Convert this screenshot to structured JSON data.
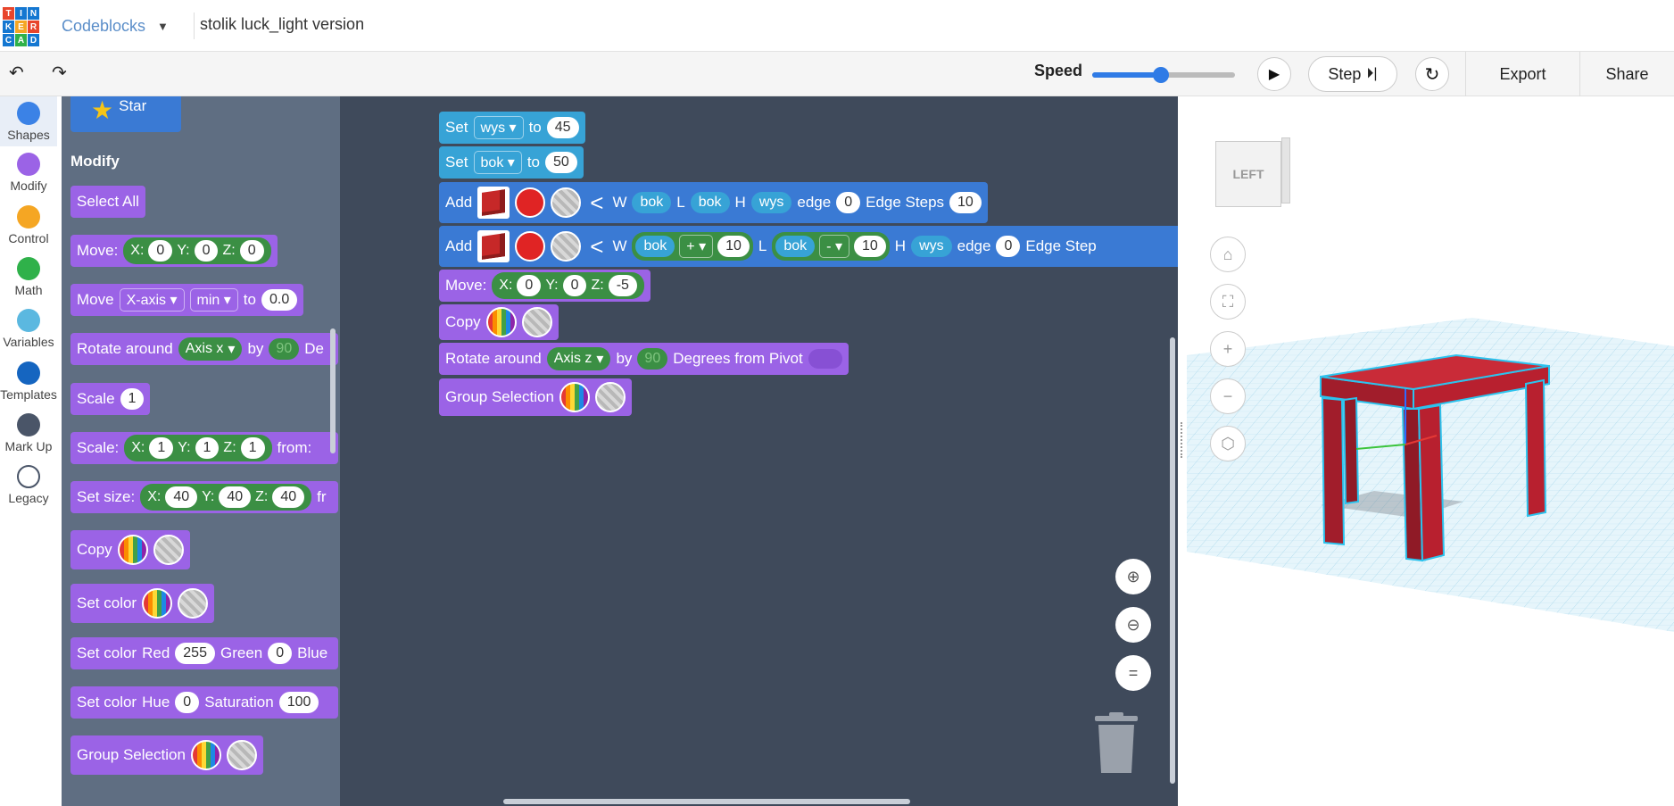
{
  "app": {
    "logo_letters": [
      "T",
      "I",
      "N",
      "K",
      "E",
      "R",
      "C",
      "A",
      "D"
    ],
    "app_name": "Codeblocks",
    "project_title": "stolik luck_light version"
  },
  "toolbar": {
    "undo": "↶",
    "redo": "↷",
    "speed_label": "Speed",
    "speed_value": 0.48,
    "step_label": "Step",
    "export_label": "Export",
    "share_label": "Share"
  },
  "categories": [
    {
      "label": "Shapes",
      "color": "#3b82e6"
    },
    {
      "label": "Modify",
      "color": "#9b63e6"
    },
    {
      "label": "Control",
      "color": "#f5a623"
    },
    {
      "label": "Math",
      "color": "#2fb14a"
    },
    {
      "label": "Variables",
      "color": "#5bb8e0"
    },
    {
      "label": "Templates",
      "color": "#1565c0"
    },
    {
      "label": "Mark Up",
      "color": "#4a5568"
    },
    {
      "label": "Legacy",
      "color": "#ffffff"
    }
  ],
  "flyout": {
    "star_label": "Star",
    "section": "Modify",
    "select_all": "Select All",
    "move": {
      "label": "Move:",
      "x": "X:",
      "xv": "0",
      "y": "Y:",
      "yv": "0",
      "z": "Z:",
      "zv": "0"
    },
    "move_axis": {
      "label": "Move",
      "axis": "X-axis",
      "mode": "min",
      "to": "to",
      "value": "0.0"
    },
    "rotate": {
      "label": "Rotate around",
      "axis": "Axis x",
      "by": "by",
      "value": "90",
      "deg": "De"
    },
    "scale": {
      "label": "Scale",
      "value": "1"
    },
    "scale_xyz": {
      "label": "Scale:",
      "x": "X:",
      "xv": "1",
      "y": "Y:",
      "yv": "1",
      "z": "Z:",
      "zv": "1",
      "from": "from:"
    },
    "set_size": {
      "label": "Set size:",
      "x": "X:",
      "xv": "40",
      "y": "Y:",
      "yv": "40",
      "z": "Z:",
      "zv": "40",
      "from": "fr"
    },
    "copy": "Copy",
    "set_color": "Set color",
    "set_color_rgb": {
      "label": "Set color",
      "red": "Red",
      "rv": "255",
      "green": "Green",
      "gv": "0",
      "blue": "Blue"
    },
    "set_color_hsv": {
      "label": "Set color",
      "hue": "Hue",
      "hv": "0",
      "sat": "Saturation",
      "sv": "100"
    },
    "group": "Group Selection"
  },
  "workspace": {
    "set1": {
      "label": "Set",
      "var": "wys",
      "to": "to",
      "value": "45"
    },
    "set2": {
      "label": "Set",
      "var": "bok",
      "to": "to",
      "value": "50"
    },
    "add1": {
      "label": "Add",
      "w": "W",
      "wv": "bok",
      "l": "L",
      "lv": "bok",
      "h": "H",
      "hv": "wys",
      "edge": "edge",
      "edgev": "0",
      "steps": "Edge Steps",
      "stepsv": "10"
    },
    "add2": {
      "label": "Add",
      "w": "W",
      "wv": "bok",
      "wop": "+",
      "wnum": "10",
      "l": "L",
      "lv": "bok",
      "lop": "-",
      "lnum": "10",
      "h": "H",
      "hv": "wys",
      "edge": "edge",
      "edgev": "0",
      "steps": "Edge Step"
    },
    "move": {
      "label": "Move:",
      "x": "X:",
      "xv": "0",
      "y": "Y:",
      "yv": "0",
      "z": "Z:",
      "zv": "-5"
    },
    "copy": "Copy",
    "rotate": {
      "label": "Rotate around",
      "axis": "Axis z",
      "by": "by",
      "value": "90",
      "deg": "Degrees from Pivot"
    },
    "group": "Group Selection"
  },
  "viewport": {
    "view_cube_face": "LEFT"
  }
}
